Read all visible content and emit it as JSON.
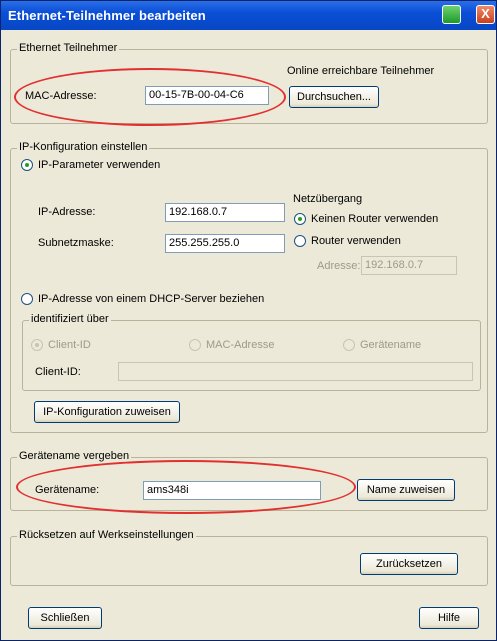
{
  "window": {
    "title": "Ethernet-Teilnehmer bearbeiten",
    "close_glyph": "X"
  },
  "ethernet": {
    "legend": "Ethernet Teilnehmer",
    "online_label": "Online erreichbare Teilnehmer",
    "mac_label": "MAC-Adresse:",
    "mac_value": "00-15-7B-00-04-C6",
    "search_button": "Durchsuchen..."
  },
  "ip_config": {
    "legend": "IP-Konfiguration einstellen",
    "use_params": "IP-Parameter verwenden",
    "ip_label": "IP-Adresse:",
    "ip_value": "192.168.0.7",
    "subnet_label": "Subnetzmaske:",
    "subnet_value": "255.255.255.0",
    "gateway_title": "Netzübergang",
    "no_router": "Keinen Router verwenden",
    "use_router": "Router verwenden",
    "router_addr_label": "Adresse:",
    "router_addr_value": "192.168.0.7",
    "dhcp": "IP-Adresse von einem DHCP-Server beziehen",
    "identified_legend": "identifiziert über",
    "client_id_radio": "Client-ID",
    "mac_radio": "MAC-Adresse",
    "device_name_radio": "Gerätename",
    "client_id_label": "Client-ID:",
    "client_id_value": "",
    "assign_button": "IP-Konfiguration zuweisen"
  },
  "device_name": {
    "legend": "Gerätename vergeben",
    "label": "Gerätename:",
    "value": "ams348i",
    "assign_button": "Name zuweisen"
  },
  "reset": {
    "legend": "Rücksetzen auf Werkseinstellungen",
    "button": "Zurücksetzen"
  },
  "footer": {
    "close_button": "Schließen",
    "help_button": "Hilfe"
  },
  "colors": {
    "title_bar": "#0a4fd6",
    "highlight_oval": "#e22f2f",
    "dialog_bg": "#ece9d8"
  }
}
